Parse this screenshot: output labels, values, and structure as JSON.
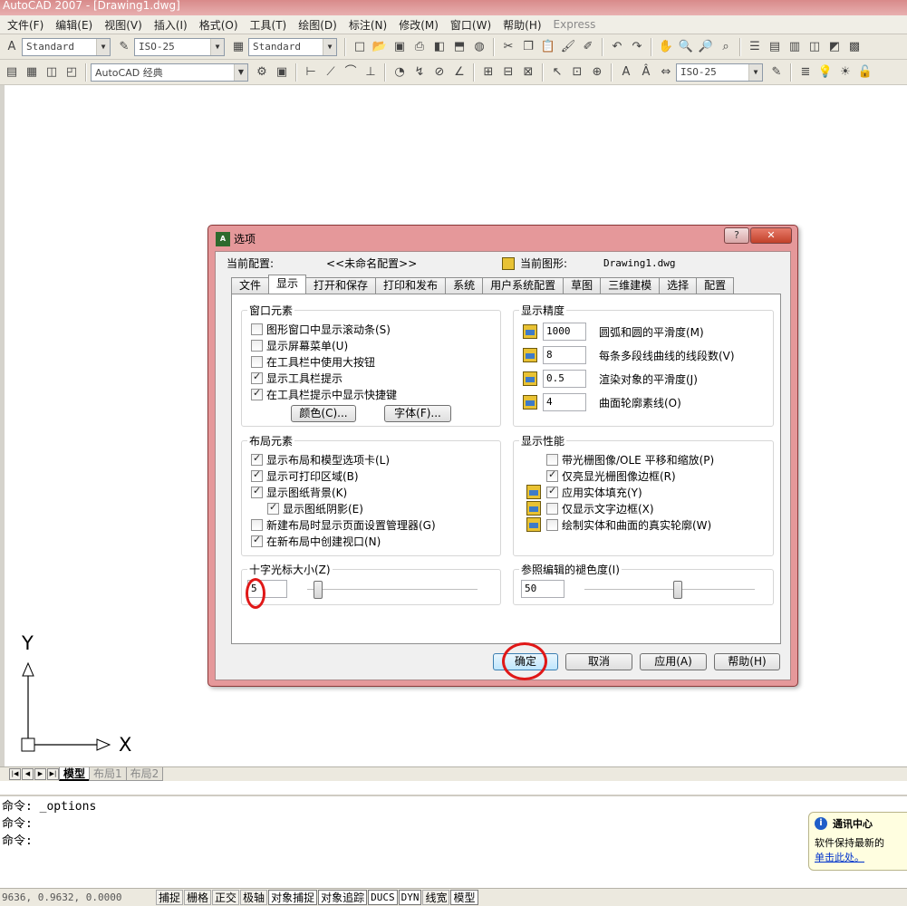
{
  "window": {
    "title": "AutoCAD 2007 - [Drawing1.dwg]"
  },
  "menu": [
    "文件(F)",
    "编辑(E)",
    "视图(V)",
    "插入(I)",
    "格式(O)",
    "工具(T)",
    "绘图(D)",
    "标注(N)",
    "修改(M)",
    "窗口(W)",
    "帮助(H)",
    "Express"
  ],
  "toolbar1": {
    "text_style": "Standard",
    "dim_style": "ISO-25",
    "table_style": "Standard"
  },
  "toolbar2": {
    "workspace": "AutoCAD 经典",
    "dim_style2": "ISO-25"
  },
  "drawing": {
    "ucs_y": "Y",
    "ucs_x": "X"
  },
  "layout_tabs": [
    "模型",
    "布局1",
    "布局2"
  ],
  "command_lines": [
    "命令: _options",
    "命令:",
    "命令:"
  ],
  "status": {
    "coords": "9636, 0.9632, 0.0000",
    "buttons": [
      "捕捉",
      "栅格",
      "正交",
      "极轴",
      "对象捕捉",
      "对象追踪",
      "DUCS",
      "DYN",
      "线宽",
      "模型"
    ]
  },
  "notification": {
    "title": "通讯中心",
    "text": "软件保持最新的",
    "link": "单击此处。"
  },
  "dialog": {
    "title": "选项",
    "help_glyph": "?",
    "close_glyph": "✕",
    "current_profile_label": "当前配置:",
    "current_profile_value": "<<未命名配置>>",
    "current_drawing_label": "当前图形:",
    "current_drawing_value": "Drawing1.dwg",
    "tabs": [
      "文件",
      "显示",
      "打开和保存",
      "打印和发布",
      "系统",
      "用户系统配置",
      "草图",
      "三维建模",
      "选择",
      "配置"
    ],
    "window_elements": {
      "title": "窗口元素",
      "checks": [
        {
          "label": "图形窗口中显示滚动条(S)",
          "checked": false
        },
        {
          "label": "显示屏幕菜单(U)",
          "checked": false
        },
        {
          "label": "在工具栏中使用大按钮",
          "checked": false
        },
        {
          "label": "显示工具栏提示",
          "checked": true
        },
        {
          "label": "在工具栏提示中显示快捷键",
          "checked": true
        }
      ],
      "color_button": "颜色(C)...",
      "font_button": "字体(F)..."
    },
    "display_resolution": {
      "title": "显示精度",
      "rows": [
        {
          "value": "1000",
          "label": "圆弧和圆的平滑度(M)"
        },
        {
          "value": "8",
          "label": "每条多段线曲线的线段数(V)"
        },
        {
          "value": "0.5",
          "label": "渲染对象的平滑度(J)"
        },
        {
          "value": "4",
          "label": "曲面轮廓素线(O)"
        }
      ]
    },
    "layout_elements": {
      "title": "布局元素",
      "checks": [
        {
          "label": "显示布局和模型选项卡(L)",
          "checked": true
        },
        {
          "label": "显示可打印区域(B)",
          "checked": true
        },
        {
          "label": "显示图纸背景(K)",
          "checked": true
        },
        {
          "label": "显示图纸阴影(E)",
          "checked": true
        },
        {
          "label": "新建布局时显示页面设置管理器(G)",
          "checked": false
        },
        {
          "label": "在新布局中创建视口(N)",
          "checked": true
        }
      ]
    },
    "display_performance": {
      "title": "显示性能",
      "checks": [
        {
          "label": "带光栅图像/OLE 平移和缩放(P)",
          "checked": false
        },
        {
          "label": "仅亮显光栅图像边框(R)",
          "checked": true
        },
        {
          "label": "应用实体填充(Y)",
          "checked": true
        },
        {
          "label": "仅显示文字边框(X)",
          "checked": false
        },
        {
          "label": "绘制实体和曲面的真实轮廓(W)",
          "checked": false
        }
      ]
    },
    "crosshair": {
      "title": "十字光标大小(Z)",
      "value": "5",
      "level_percent": 5
    },
    "xref_fade": {
      "title": "参照编辑的褪色度(I)",
      "value": "50",
      "level_percent": 50
    },
    "buttons": {
      "ok": "确定",
      "cancel": "取消",
      "apply": "应用(A)",
      "help": "帮助(H)"
    }
  },
  "colors": {
    "dialog_frame": "#e5989a",
    "annotation_red": "#e01818",
    "check_mark": "#222222"
  }
}
